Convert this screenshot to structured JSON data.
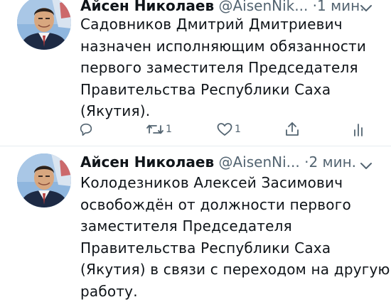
{
  "tweets": [
    {
      "display_name": "Айсен Николаев",
      "handle": "@AisenNik...",
      "dot": "·",
      "time": "1 мин.",
      "text_lines": [
        "Садовников Дмитрий Дмитриевич",
        "назначен исполняющим обязанности",
        "первого заместителя Председателя",
        "Правительства Республики Саха",
        "(Якутия)."
      ],
      "actions": {
        "reply_count": "",
        "retweet_count": "1",
        "like_count": "1",
        "share_count": "",
        "analytics_count": ""
      }
    },
    {
      "display_name": "Айсен Николаев",
      "handle": "@AisenNi...",
      "dot": "·",
      "time": "2 мин.",
      "text_lines": [
        "Колодезников Алексей Засимович",
        "освобождён от должности первого",
        "заместителя Председателя",
        "Правительства Республики Саха",
        "(Якутия) в связи с переходом на другую",
        "работу."
      ]
    }
  ],
  "icons": {
    "reply": "reply-icon",
    "retweet": "retweet-icon",
    "like": "like-icon",
    "share": "share-icon",
    "analytics": "analytics-icon",
    "more": "chevron-down-icon"
  },
  "colors": {
    "text": "#0f1419",
    "secondary": "#536471",
    "divider": "#e6ecf0"
  }
}
